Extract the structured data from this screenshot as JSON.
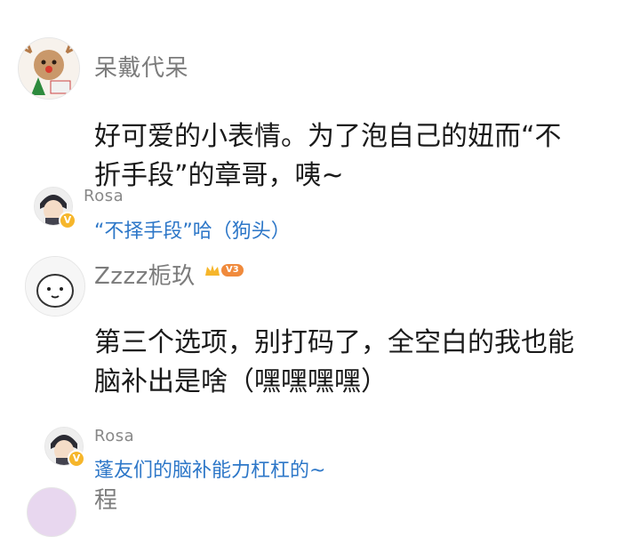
{
  "comments": [
    {
      "username": "呆戴代呆",
      "text_line1": "好可爱的小表情。为了泡自己的妞而“不",
      "text_line2": "折手段”的章哥，咦~",
      "avatar_icon": "reindeer-christmas-avatar-icon",
      "reply": {
        "username": "Rosa",
        "text": "“不择手段”哈（狗头）",
        "verified": "V"
      }
    },
    {
      "username": "Zzzz栀玖",
      "level_badge": "V3",
      "text_line1": "第三个选项，别打码了，全空白的我也能",
      "text_line2": "脑补出是啥（嘿嘿嘿嘿）",
      "avatar_icon": "cartoon-bunny-avatar-icon",
      "reply": {
        "username": "Rosa",
        "text": "蓬友们的脑补能力杠杠的~",
        "verified": "V"
      }
    },
    {
      "username": "程"
    }
  ],
  "colors": {
    "link_blue": "#2d77c8",
    "username_gray": "#7c7c7c",
    "badge_orange": "#f08a3c",
    "verified_gold": "#f6b62b"
  }
}
